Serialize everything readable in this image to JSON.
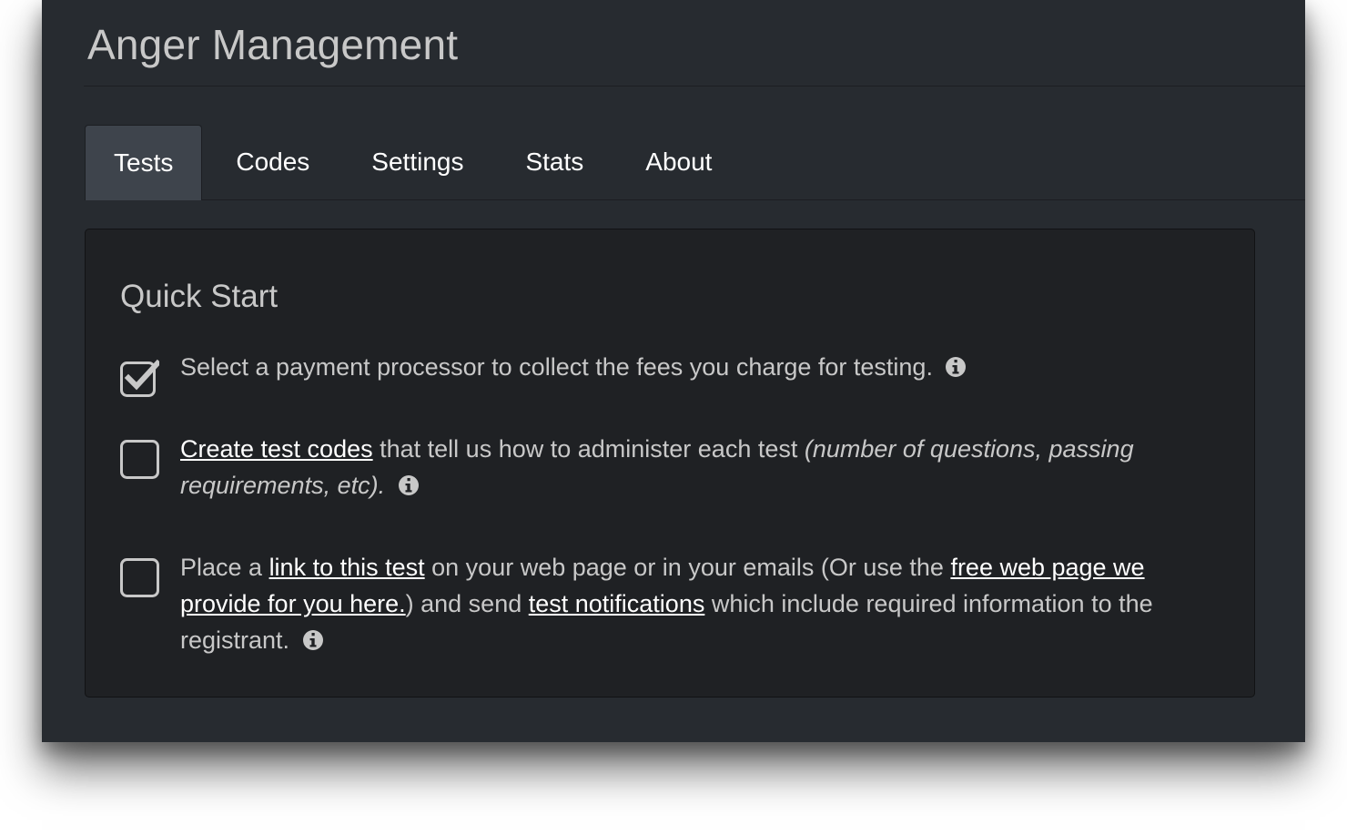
{
  "app": {
    "title": "Anger Management"
  },
  "tabs": [
    {
      "label": "Tests",
      "active": true
    },
    {
      "label": "Codes",
      "active": false
    },
    {
      "label": "Settings",
      "active": false
    },
    {
      "label": "Stats",
      "active": false
    },
    {
      "label": "About",
      "active": false
    }
  ],
  "quick_start": {
    "title": "Quick Start",
    "items": [
      {
        "checked": true,
        "text": "Select a payment processor to collect the fees you charge for testing."
      },
      {
        "checked": false,
        "link": "Create test codes",
        "text": " that tell us how to administer each test ",
        "italic": "(number of questions, passing requirements, etc)."
      },
      {
        "checked": false,
        "text_1": "Place a ",
        "link_1": "link to this test",
        "text_2": " on your web page or in your emails (Or use the ",
        "link_2": "free web page we provide for you here.",
        "text_3": ") and send ",
        "link_3": "test notifications",
        "text_4": " which include required information to the registrant."
      }
    ]
  },
  "icons": {
    "info": "info-circle-icon",
    "checked": "checkbox-checked-icon",
    "unchecked": "checkbox-empty-icon"
  },
  "colors": {
    "background": "#272b30",
    "panel": "#1f2124",
    "active_tab": "#3e444c",
    "text": "#c8c8c8",
    "link": "#ffffff"
  }
}
